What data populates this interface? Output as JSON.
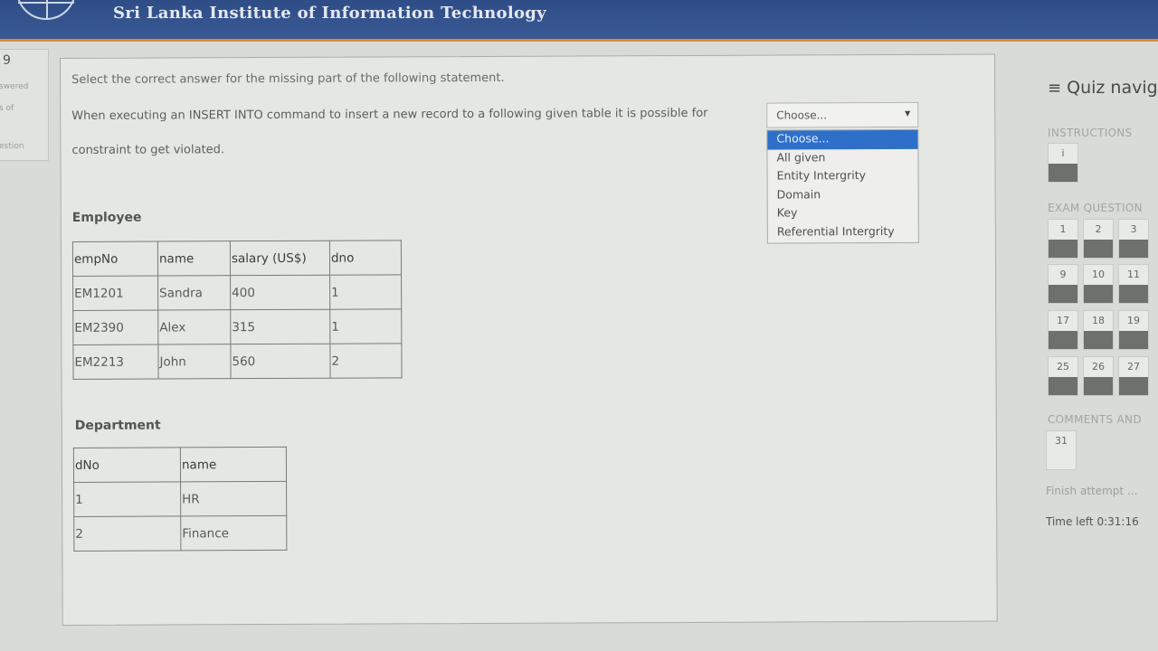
{
  "header": {
    "title": "Sri Lanka Institute of Information Technology"
  },
  "sidebar_info": {
    "question_number": "9",
    "line1": "swered",
    "line2": "s of",
    "line3": "estion"
  },
  "question": {
    "prompt": "Select the correct answer for the missing part of the following statement.",
    "statement_part1": "When executing an INSERT INTO command to insert a new record to a following given table it is possible for",
    "statement_part2": "constraint to get violated."
  },
  "select": {
    "current_value": "Choose...",
    "options": [
      "Choose...",
      "All given",
      "Entity Intergrity",
      "Domain",
      "Key",
      "Referential Intergrity"
    ]
  },
  "employee_table": {
    "title": "Employee",
    "headers": [
      "empNo",
      "name",
      "salary (US$)",
      "dno"
    ],
    "rows": [
      [
        "EM1201",
        "Sandra",
        "400",
        "1"
      ],
      [
        "EM2390",
        "Alex",
        "315",
        "1"
      ],
      [
        "EM2213",
        "John",
        "560",
        "2"
      ]
    ]
  },
  "department_table": {
    "title": "Department",
    "headers": [
      "dNo",
      "name"
    ],
    "rows": [
      [
        "1",
        "HR"
      ],
      [
        "2",
        "Finance"
      ]
    ]
  },
  "quiz_nav": {
    "title": "Quiz navig",
    "instructions_label": "INSTRUCTIONS",
    "instructions_button": "i",
    "exam_questions_label": "EXAM QUESTION",
    "rows": [
      [
        "1",
        "2",
        "3"
      ],
      [
        "9",
        "10",
        "11"
      ],
      [
        "17",
        "18",
        "19"
      ],
      [
        "25",
        "26",
        "27"
      ]
    ],
    "comments_label": "COMMENTS AND",
    "comments_button": "31",
    "finish_label": "Finish attempt ...",
    "time_left_label": "Time left",
    "time_left_value": "0:31:16"
  }
}
